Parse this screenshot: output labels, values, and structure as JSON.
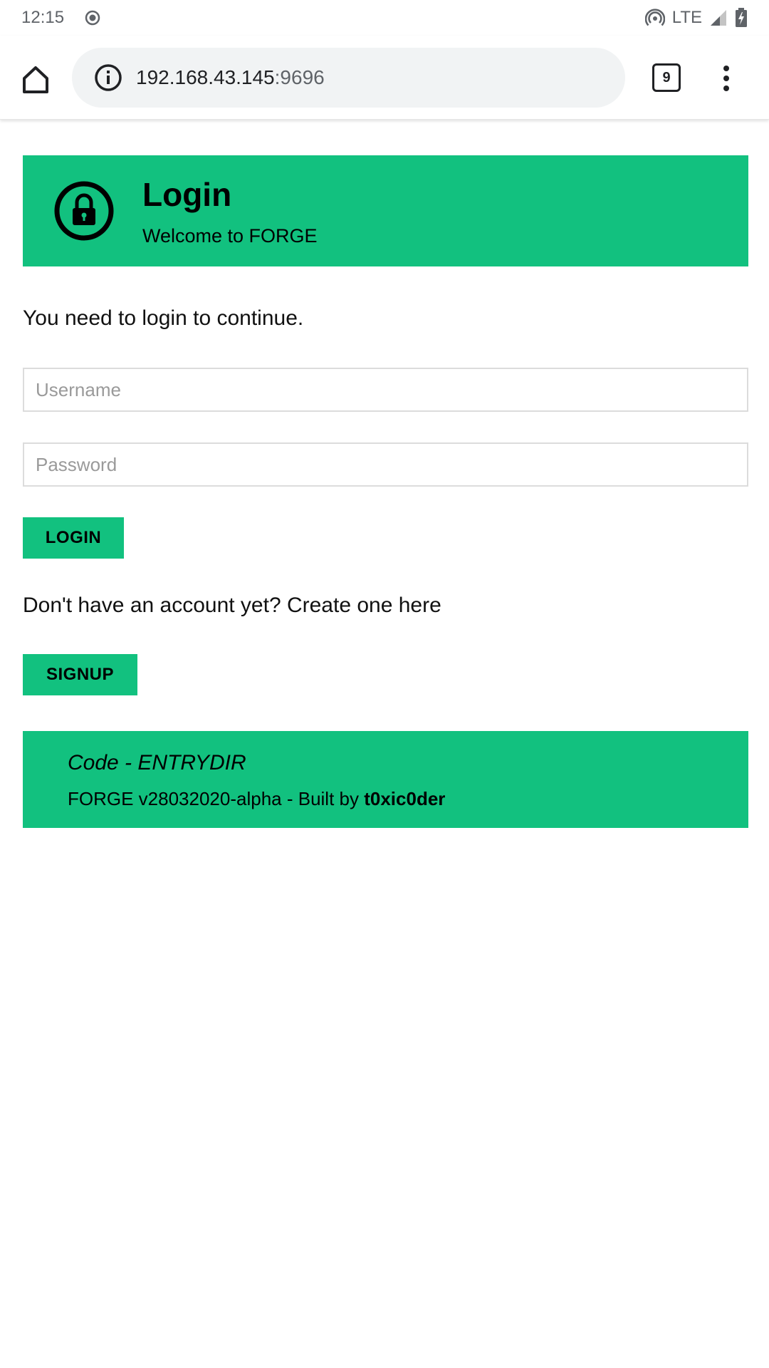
{
  "status_bar": {
    "time": "12:15",
    "network": "LTE"
  },
  "browser": {
    "url_host": "192.168.43.145",
    "url_port": ":9696",
    "tab_count": "9"
  },
  "header": {
    "title": "Login",
    "subtitle": "Welcome to FORGE"
  },
  "form": {
    "intro": "You need to login to continue.",
    "username_placeholder": "Username",
    "password_placeholder": "Password",
    "login_label": "LOGIN",
    "signup_prompt": "Don't have an account yet? Create one here",
    "signup_label": "SIGNUP"
  },
  "footer": {
    "code": "Code - ENTRYDIR",
    "version_prefix": "FORGE v28032020-alpha - Built by ",
    "author": "t0xic0der"
  },
  "colors": {
    "accent": "#12c17f",
    "url_bar_bg": "#f1f3f4"
  },
  "icons": {
    "status_left": "record-icon",
    "hotspot": "hotspot-icon",
    "signal": "signal-icon",
    "battery": "battery-charging-icon",
    "home": "home-icon",
    "info": "info-icon",
    "tabs": "tab-switcher-icon",
    "menu": "more-vert-icon",
    "lock": "lock-icon"
  }
}
